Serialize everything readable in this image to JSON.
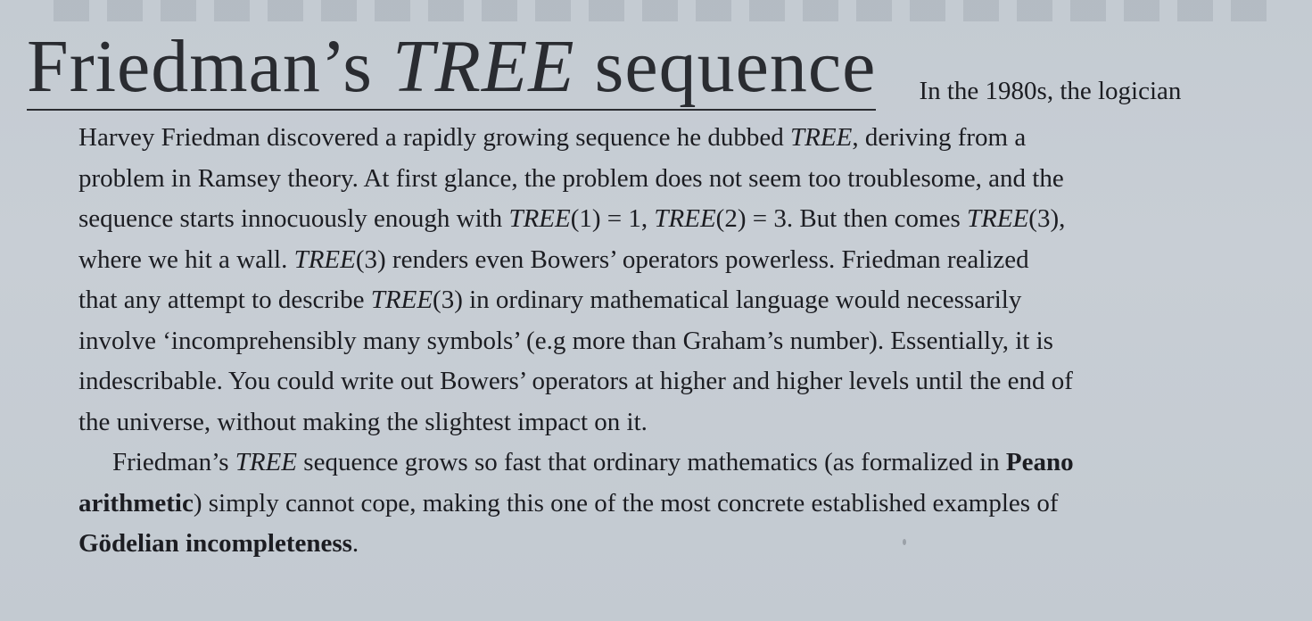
{
  "heading": {
    "part1": "Friedman’s ",
    "italic": "TREE",
    "part2": " sequence"
  },
  "lead_in": "In the 1980s, the logician",
  "paragraph1": {
    "line1": {
      "a": "Harvey Friedman discovered a rapidly growing sequence he dubbed ",
      "i": "TREE",
      "b": ", deriving from a"
    },
    "line2": "problem in Ramsey theory. At first glance, the problem does not seem too troublesome, and the",
    "line3": {
      "a": "sequence starts innocuously enough with ",
      "i1": "TREE",
      "b": "(1) = 1, ",
      "i2": "TREE",
      "c": "(2) = 3. But then comes ",
      "i3": "TREE",
      "d": "(3),"
    },
    "line4": {
      "a": "where we hit a wall. ",
      "i": "TREE",
      "b": "(3) renders even Bowers’ operators powerless. Friedman realized"
    },
    "line5": {
      "a": "that any attempt to describe ",
      "i": "TREE",
      "b": "(3) in ordinary mathematical language would necessarily"
    },
    "line6": "involve ‘incomprehensibly many symbols’ (e.g more than Graham’s number). Essentially, it is",
    "line7": "indescribable. You could write out Bowers’ operators at higher and higher levels until the end of",
    "line8": "the universe, without making the slightest impact on it."
  },
  "paragraph2": {
    "line1": {
      "a": "Friedman’s ",
      "i": "TREE",
      "b": " sequence grows so fast that ordinary mathematics (as formalized in ",
      "bold": "Peano"
    },
    "line2": {
      "bold": "arithmetic",
      "a": ") simply cannot cope, making this one of the most concrete established examples of"
    },
    "line3": {
      "bold": "Gödelian incompleteness",
      "a": "."
    }
  }
}
